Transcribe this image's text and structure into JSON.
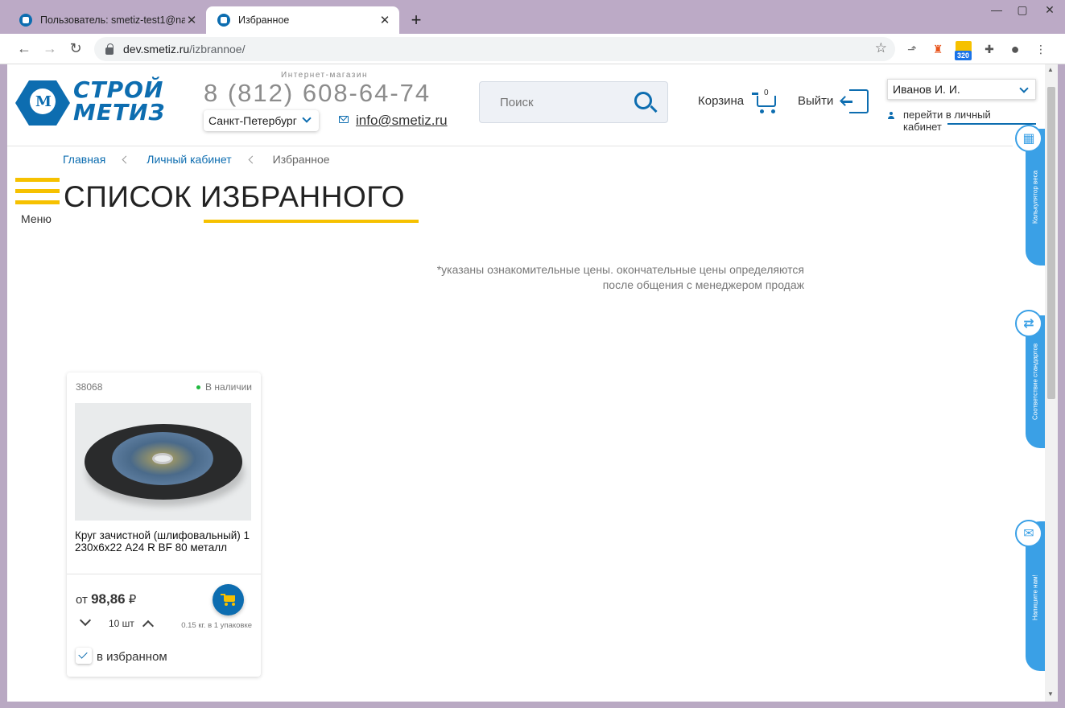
{
  "browser": {
    "tabs": [
      {
        "title": "Пользователь: smetiz-test1@na",
        "active": false
      },
      {
        "title": "Избранное",
        "active": true
      }
    ],
    "new_tab_icon": "+",
    "url_host": "dev.smetiz.ru",
    "url_path": "/izbrannoe/",
    "extension_badge": "320"
  },
  "header": {
    "logo_line1": "СТРОЙ",
    "logo_line2": "МЕТИЗ",
    "logo_letter": "M",
    "shop_label": "Интернет-магазин",
    "phone": "8 (812) 608-64-74",
    "city": "Санкт-Петербург",
    "email": "info@smetiz.ru",
    "search_placeholder": "Поиск",
    "cart_label": "Корзина",
    "cart_count": "0",
    "logout_label": "Выйти",
    "user_name": "Иванов И. И.",
    "cabinet_link": "перейти в личный кабинет"
  },
  "breadcrumb": [
    {
      "label": "Главная",
      "link": true
    },
    {
      "label": "Личный кабинет",
      "link": true
    },
    {
      "label": "Избранное",
      "link": false
    }
  ],
  "menu_label": "Меню",
  "page_title": "СПИСОК ИЗБРАННОГО",
  "price_note_line1": "*указаны ознакомительные цены. окончательные цены определяются",
  "price_note_line2": "после общения с менеджером продаж",
  "product": {
    "sku": "38068",
    "stock": "В наличии",
    "name": "Круг зачистной (шлифовальный) 1 230х6х22 A24 R BF 80 металл",
    "price_prefix": "от",
    "price": "98,86",
    "currency": "₽",
    "quantity": "10 шт",
    "pack_info": "0.15 кг. в 1 упаковке",
    "favorite_label": "в избранном",
    "favorite_checked": true
  },
  "side_widgets": [
    {
      "label": "Калькулятор веса",
      "icon": "calculator-icon"
    },
    {
      "label": "Соответствие стандартов",
      "icon": "swap-arrows-icon"
    },
    {
      "label": "Напишите нам!",
      "icon": "chat-icon"
    }
  ],
  "colors": {
    "brand_blue": "#0d6db0",
    "accent_yellow": "#f6c100",
    "side_blue": "#3aa0e6",
    "in_stock_green": "#1fb83e"
  }
}
